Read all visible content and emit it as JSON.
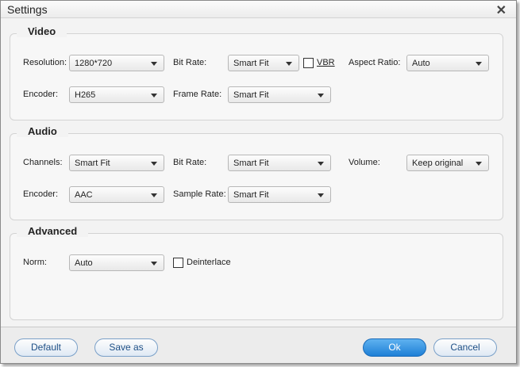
{
  "window": {
    "title": "Settings"
  },
  "video": {
    "legend": "Video",
    "resolution": {
      "label": "Resolution:",
      "value": "1280*720"
    },
    "bitrate": {
      "label": "Bit Rate:",
      "value": "Smart Fit"
    },
    "vbr": {
      "label": "VBR",
      "checked": false
    },
    "aspect": {
      "label": "Aspect Ratio:",
      "value": "Auto"
    },
    "encoder": {
      "label": "Encoder:",
      "value": "H265"
    },
    "framerate": {
      "label": "Frame Rate:",
      "value": "Smart Fit"
    }
  },
  "audio": {
    "legend": "Audio",
    "channels": {
      "label": "Channels:",
      "value": "Smart Fit"
    },
    "bitrate": {
      "label": "Bit Rate:",
      "value": "Smart Fit"
    },
    "volume": {
      "label": "Volume:",
      "value": "Keep original"
    },
    "encoder": {
      "label": "Encoder:",
      "value": "AAC"
    },
    "samplerate": {
      "label": "Sample Rate:",
      "value": "Smart Fit"
    }
  },
  "advanced": {
    "legend": "Advanced",
    "norm": {
      "label": "Norm:",
      "value": "Auto"
    },
    "deinterlace": {
      "label": "Deinterlace",
      "checked": false
    }
  },
  "buttons": {
    "default": "Default",
    "save_as": "Save as",
    "ok": "Ok",
    "cancel": "Cancel"
  },
  "colors": {
    "primary_button": "#1e7fd6",
    "button_text": "#1e4f86"
  },
  "icons": {
    "close": "close-icon"
  }
}
